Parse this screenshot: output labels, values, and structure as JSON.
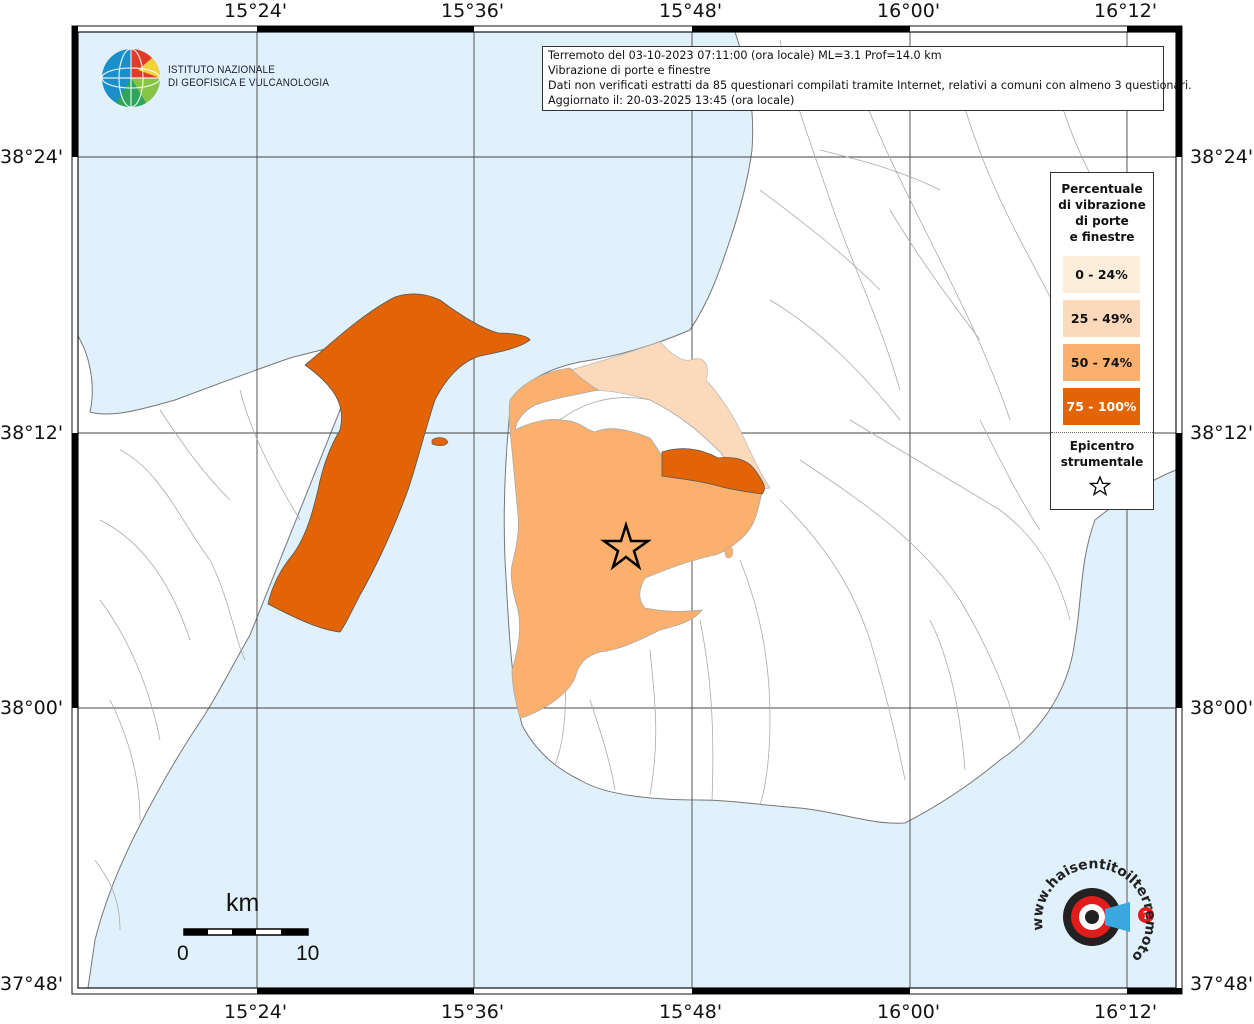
{
  "map": {
    "top_lon_labels": [
      "15°24'",
      "15°36'",
      "15°48'",
      "16°00'",
      "16°12'"
    ],
    "bottom_lon_labels": [
      "15°24'",
      "15°36'",
      "15°48'",
      "16°00'",
      "16°12'"
    ],
    "left_lat_labels": [
      "38°24'",
      "38°12'",
      "38°00'",
      "37°48'"
    ],
    "right_lat_labels": [
      "38°24'",
      "38°12'",
      "38°00'",
      "37°48'"
    ],
    "colors": {
      "sea": "#e0f1fc",
      "land": "#ffffff",
      "class_0_24": "#fdeedc",
      "class_25_49": "#fdd9bb",
      "class_50_74": "#fbb06e",
      "class_75_100": "#e26404"
    }
  },
  "info": {
    "line1": "Terremoto del 03-10-2023 07:11:00 (ora locale) ML=3.1 Prof=14.0 km",
    "line2": "Vibrazione di porte e finestre",
    "line3": "Dati non verificati estratti da 85 questionari compilati tramite Internet, relativi a comuni con almeno 3 questionari.",
    "line4": "Aggiornato il: 20-03-2025 13:45 (ora locale)"
  },
  "legend": {
    "title_line1": "Percentuale",
    "title_line2": "di vibrazione",
    "title_line3": "di porte",
    "title_line4": "e finestre",
    "classes": [
      "0 - 24%",
      "25 - 49%",
      "50 - 74%",
      "75 - 100%"
    ],
    "epicenter_line1": "Epicentro",
    "epicenter_line2": "strumentale",
    "star_icon": "star-outline-icon"
  },
  "logo": {
    "line1": "ISTITUTO NAZIONALE",
    "line2": "DI GEOFISICA E VULCANOLOGIA"
  },
  "scalebar": {
    "unit": "km",
    "start": "0",
    "end": "10"
  },
  "stamp": {
    "text": "www.haisentitoilterremoto.it"
  }
}
